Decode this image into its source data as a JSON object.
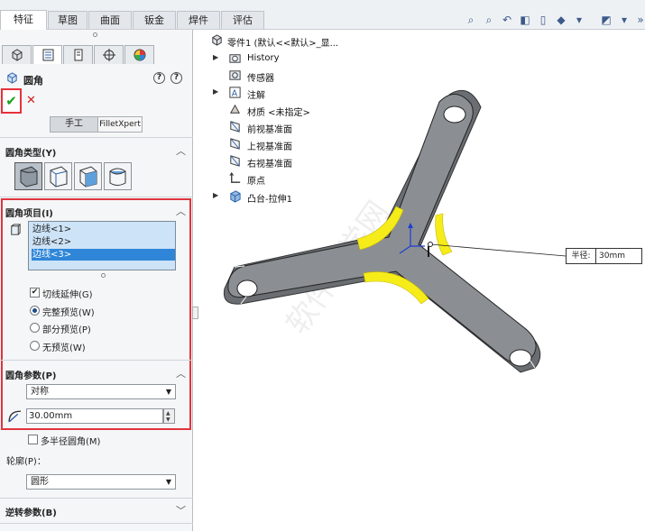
{
  "tabs": [
    {
      "label": "特征"
    },
    {
      "label": "草图"
    },
    {
      "label": "曲面"
    },
    {
      "label": "钣金"
    },
    {
      "label": "焊件"
    },
    {
      "label": "评估"
    }
  ],
  "property_manager": {
    "title": "圆角",
    "help_symbols": [
      "?",
      "?"
    ],
    "ok_symbol": "✔",
    "cancel_symbol": "✕",
    "mode_manual": "手工",
    "mode_xpert": "FilletXpert",
    "fillet_type": {
      "title": "圆角类型(Y)"
    },
    "fillet_items": {
      "title": "圆角项目(I)",
      "edges": [
        "边线<1>",
        "边线<2>",
        "边线<3>"
      ],
      "selected_edge": "边线<3>",
      "tangent_propagation": {
        "label": "切线延伸(G)",
        "checked": true
      },
      "preview_options": [
        {
          "label": "完整预览(W)",
          "selected": true
        },
        {
          "label": "部分预览(P)",
          "selected": false
        },
        {
          "label": "无预览(W)",
          "selected": false
        }
      ]
    },
    "fillet_params": {
      "title": "圆角参数(P)",
      "method": "对称",
      "radius": "30.00mm",
      "multi_radius": {
        "label": "多半径圆角(M)",
        "checked": false
      },
      "profile_label": "轮廓(P)：",
      "profile": "圆形"
    },
    "setback": {
      "title": "逆转参数(B)"
    }
  },
  "tree": {
    "root": "零件1  (默认<<默认>_显...",
    "items": [
      {
        "label": "History",
        "expandable": true
      },
      {
        "label": "传感器",
        "expandable": false
      },
      {
        "label": "注解",
        "expandable": true
      },
      {
        "label": "材质 <未指定>",
        "expandable": false
      },
      {
        "label": "前视基准面",
        "expandable": false
      },
      {
        "label": "上视基准面",
        "expandable": false
      },
      {
        "label": "右视基准面",
        "expandable": false
      },
      {
        "label": "原点",
        "expandable": false
      },
      {
        "label": "凸台-拉伸1",
        "expandable": true
      }
    ]
  },
  "dimension": {
    "label": "半径:",
    "value": "30mm"
  },
  "colors": {
    "highlight": "#e0353f",
    "selection": "#2f86d8",
    "part": "#8b8f93",
    "fillet_preview": "#f5ec1a"
  }
}
